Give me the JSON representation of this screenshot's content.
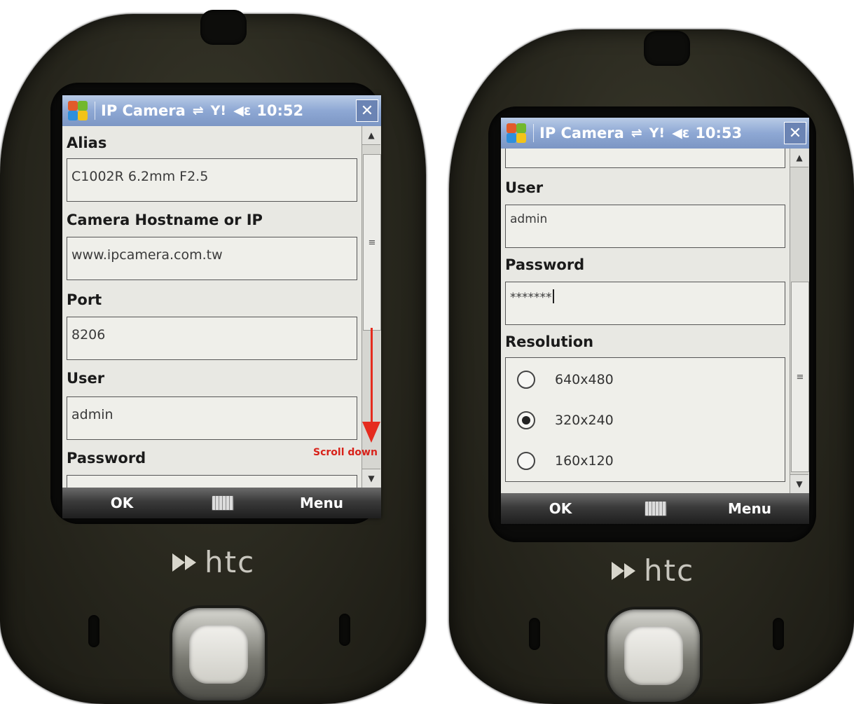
{
  "left_phone": {
    "title": "IP Camera",
    "clock": "10:52",
    "fields": [
      {
        "label": "Alias",
        "value": "C1002R 6.2mm F2.5"
      },
      {
        "label": "Camera Hostname or IP",
        "value": "www.ipcamera.com.tw"
      },
      {
        "label": "Port",
        "value": "8206"
      },
      {
        "label": "User",
        "value": "admin"
      },
      {
        "label": "Password",
        "value": ""
      }
    ],
    "annotation": "Scroll down",
    "softkeys": {
      "left": "OK",
      "right": "Menu"
    },
    "brand": "htc"
  },
  "right_phone": {
    "title": "IP Camera",
    "clock": "10:53",
    "fields": [
      {
        "label": "User",
        "value": "admin"
      },
      {
        "label": "Password",
        "value": "*******"
      }
    ],
    "resolution": {
      "label": "Resolution",
      "options": [
        "640x480",
        "320x240",
        "160x120"
      ],
      "selected": "320x240"
    },
    "softkeys": {
      "left": "OK",
      "right": "Menu"
    },
    "brand": "htc"
  },
  "icons": {
    "start": "windows-start-icon",
    "connectivity": "connectivity-icon",
    "signal": "signal-icon",
    "volume": "volume-icon",
    "close": "close-icon",
    "keyboard": "keyboard-icon"
  },
  "colors": {
    "title_bar": "#8ea8d4",
    "screen_bg": "#e8e8e3",
    "annotation": "#e52b1e",
    "device_body": "#2b2a20"
  }
}
